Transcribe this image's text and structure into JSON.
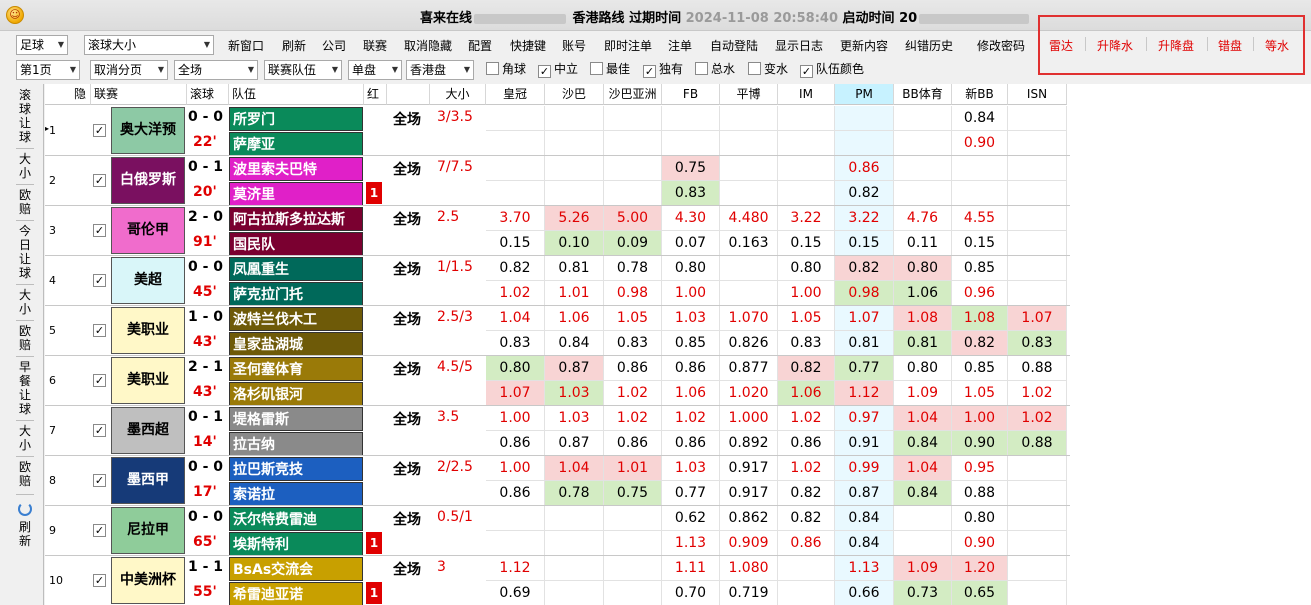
{
  "window": {
    "title_prefix": "喜来在线",
    "title_route": "香港路线",
    "title_expiry_label": "过期时间",
    "title_expiry": "2024-11-08 20:58:40",
    "title_start_label": "启动时间",
    "title_start": "20"
  },
  "toolbar1": {
    "sport_select": "足球",
    "market_select": "滚球大小",
    "buttons": [
      "新窗口",
      "刷新",
      "公司",
      "联赛",
      "取消隐藏",
      "配置",
      "快捷键",
      "账号",
      "即时注单",
      "注单",
      "自动登陆",
      "显示日志",
      "更新内容",
      "纠错历史",
      "修改密码"
    ],
    "red_buttons": [
      "雷达",
      "升降水",
      "升降盘",
      "错盘",
      "等水"
    ]
  },
  "toolbar2": {
    "page_select": "第1页",
    "paging_select": "取消分页",
    "period_select": "全场",
    "team_select": "联赛队伍",
    "line_select": "单盘",
    "odds_select": "香港盘",
    "checkboxes": [
      {
        "label": "角球",
        "checked": false
      },
      {
        "label": "中立",
        "checked": true
      },
      {
        "label": "最佳",
        "checked": false
      },
      {
        "label": "独有",
        "checked": true
      },
      {
        "label": "总水",
        "checked": false
      },
      {
        "label": "变水",
        "checked": false
      },
      {
        "label": "队伍颜色",
        "checked": true
      }
    ]
  },
  "side_tabs": [
    "滚球让球",
    "大小",
    "欧赔",
    "今日让球",
    "大小",
    "欧赔",
    "早餐让球",
    "大小",
    "欧赔",
    "刷新"
  ],
  "columns": {
    "hide": "隐",
    "league": "联赛",
    "live": "滚球",
    "team": "队伍",
    "red": "红",
    "total": "大小",
    "books": [
      "皇冠",
      "沙巴",
      "沙巴亚洲",
      "FB",
      "平博",
      "IM",
      "PM",
      "BB体育",
      "新BB",
      "ISN"
    ]
  },
  "colors": {
    "pink": "#f8d4d4",
    "green": "#d3ecc3",
    "red_text": "#e00000",
    "pm_header": "#c7f2ff"
  },
  "matches": [
    {
      "num": "1",
      "league": "奥大洋预",
      "league_bg": "#8dc9a5",
      "score": "0 - 0",
      "minute": "22'",
      "home": "所罗门",
      "away": "萨摩亚",
      "home_bg": "#0a8a5a",
      "away_bg": "#0a8a5a",
      "red": "",
      "period": "全场",
      "line": "3/3.5",
      "odds": [
        [
          [
            "",
            ""
          ],
          [
            "",
            ""
          ]
        ],
        [
          [
            "",
            ""
          ],
          [
            "",
            ""
          ]
        ],
        [
          [
            "",
            ""
          ],
          [
            "",
            ""
          ]
        ],
        [
          [
            "",
            ""
          ],
          [
            "",
            ""
          ]
        ],
        [
          [
            "",
            ""
          ],
          [
            "",
            ""
          ]
        ],
        [
          [
            "",
            ""
          ],
          [
            "",
            ""
          ]
        ],
        [
          [
            "",
            ""
          ],
          [
            "",
            ""
          ]
        ],
        [
          [
            "",
            ""
          ],
          [
            "",
            ""
          ]
        ],
        [
          [
            "0.84",
            ""
          ],
          [
            "0.90",
            "r"
          ]
        ],
        [
          [
            "",
            ""
          ],
          [
            "",
            ""
          ]
        ]
      ]
    },
    {
      "num": "2",
      "league": "白俄罗斯",
      "league_bg": "#7a1060",
      "score": "0 - 1",
      "minute": "20'",
      "home": "波里索夫巴特",
      "away": "莫济里",
      "home_bg": "#e020c8",
      "away_bg": "#e020c8",
      "red": "1",
      "period": "全场",
      "line": "7/7.5",
      "odds": [
        [
          [
            "",
            ""
          ],
          [
            "",
            ""
          ]
        ],
        [
          [
            "",
            ""
          ],
          [
            "",
            ""
          ]
        ],
        [
          [
            "",
            ""
          ],
          [
            "",
            ""
          ]
        ],
        [
          [
            "0.75",
            "p"
          ],
          [
            "0.83",
            "g"
          ]
        ],
        [
          [
            "",
            ""
          ],
          [
            "",
            ""
          ]
        ],
        [
          [
            "",
            ""
          ],
          [
            "",
            ""
          ]
        ],
        [
          [
            "0.86",
            "r"
          ],
          [
            "0.82",
            ""
          ]
        ],
        [
          [
            "",
            ""
          ],
          [
            "",
            ""
          ]
        ],
        [
          [
            "",
            ""
          ],
          [
            "",
            ""
          ]
        ],
        [
          [
            "",
            ""
          ],
          [
            "",
            ""
          ]
        ]
      ]
    },
    {
      "num": "3",
      "league": "哥伦甲",
      "league_bg": "#f06ccc",
      "score": "2 - 0",
      "minute": "91'",
      "home": "阿古拉斯多拉达斯",
      "away": "国民队",
      "home_bg": "#7a0030",
      "away_bg": "#7a0030",
      "red": "",
      "period": "全场",
      "line": "2.5",
      "odds": [
        [
          [
            "3.70",
            "r"
          ],
          [
            "0.15",
            ""
          ]
        ],
        [
          [
            "5.26",
            "pr"
          ],
          [
            "0.10",
            "g"
          ]
        ],
        [
          [
            "5.00",
            "pr"
          ],
          [
            "0.09",
            "g"
          ]
        ],
        [
          [
            "4.30",
            "r"
          ],
          [
            "0.07",
            ""
          ]
        ],
        [
          [
            "4.480",
            "r"
          ],
          [
            "0.163",
            ""
          ]
        ],
        [
          [
            "3.22",
            "r"
          ],
          [
            "0.15",
            ""
          ]
        ],
        [
          [
            "3.22",
            "r"
          ],
          [
            "0.15",
            ""
          ]
        ],
        [
          [
            "4.76",
            "r"
          ],
          [
            "0.11",
            ""
          ]
        ],
        [
          [
            "4.55",
            "r"
          ],
          [
            "0.15",
            ""
          ]
        ],
        [
          [
            "",
            ""
          ],
          [
            "",
            ""
          ]
        ]
      ]
    },
    {
      "num": "4",
      "league": "美超",
      "league_bg": "#d9f6f9",
      "score": "0 - 0",
      "minute": "45'",
      "home": "凤凰重生",
      "away": "萨克拉门托",
      "home_bg": "#00695a",
      "away_bg": "#00695a",
      "red": "",
      "period": "全场",
      "line": "1/1.5",
      "odds": [
        [
          [
            "0.82",
            ""
          ],
          [
            "1.02",
            "r"
          ]
        ],
        [
          [
            "0.81",
            ""
          ],
          [
            "1.01",
            "r"
          ]
        ],
        [
          [
            "0.78",
            ""
          ],
          [
            "0.98",
            "r"
          ]
        ],
        [
          [
            "0.80",
            ""
          ],
          [
            "1.00",
            "r"
          ]
        ],
        [
          [
            "",
            ""
          ],
          [
            "",
            ""
          ]
        ],
        [
          [
            "0.80",
            ""
          ],
          [
            "1.00",
            "r"
          ]
        ],
        [
          [
            "0.82",
            "p"
          ],
          [
            "0.98",
            "gr"
          ]
        ],
        [
          [
            "0.80",
            "p"
          ],
          [
            "1.06",
            "g"
          ]
        ],
        [
          [
            "0.85",
            ""
          ],
          [
            "0.96",
            "r"
          ]
        ],
        [
          [
            "",
            ""
          ],
          [
            "",
            ""
          ]
        ]
      ]
    },
    {
      "num": "5",
      "league": "美职业",
      "league_bg": "#fff8c8",
      "score": "1 - 0",
      "minute": "43'",
      "home": "波特兰伐木工",
      "away": "皇家盐湖城",
      "home_bg": "#6e5a08",
      "away_bg": "#6e5a08",
      "red": "",
      "period": "全场",
      "line": "2.5/3",
      "odds": [
        [
          [
            "1.04",
            "r"
          ],
          [
            "0.83",
            ""
          ]
        ],
        [
          [
            "1.06",
            "r"
          ],
          [
            "0.84",
            ""
          ]
        ],
        [
          [
            "1.05",
            "r"
          ],
          [
            "0.83",
            ""
          ]
        ],
        [
          [
            "1.03",
            "r"
          ],
          [
            "0.85",
            ""
          ]
        ],
        [
          [
            "1.070",
            "r"
          ],
          [
            "0.826",
            ""
          ]
        ],
        [
          [
            "1.05",
            "r"
          ],
          [
            "0.83",
            ""
          ]
        ],
        [
          [
            "1.07",
            "r"
          ],
          [
            "0.81",
            ""
          ]
        ],
        [
          [
            "1.08",
            "pr"
          ],
          [
            "0.81",
            "g"
          ]
        ],
        [
          [
            "1.08",
            "gr"
          ],
          [
            "0.82",
            "p"
          ]
        ],
        [
          [
            "1.07",
            "pr"
          ],
          [
            "0.83",
            "g"
          ]
        ]
      ]
    },
    {
      "num": "6",
      "league": "美职业",
      "league_bg": "#fff8c8",
      "score": "2 - 1",
      "minute": "43'",
      "home": "圣何塞体育",
      "away": "洛杉矶银河",
      "home_bg": "#9a7a08",
      "away_bg": "#9a7a08",
      "red": "",
      "period": "全场",
      "line": "4.5/5",
      "odds": [
        [
          [
            "0.80",
            "g"
          ],
          [
            "1.07",
            "pr"
          ]
        ],
        [
          [
            "0.87",
            "p"
          ],
          [
            "1.03",
            "gr"
          ]
        ],
        [
          [
            "0.86",
            ""
          ],
          [
            "1.02",
            "r"
          ]
        ],
        [
          [
            "0.86",
            ""
          ],
          [
            "1.06",
            "r"
          ]
        ],
        [
          [
            "0.877",
            ""
          ],
          [
            "1.020",
            "r"
          ]
        ],
        [
          [
            "0.82",
            "p"
          ],
          [
            "1.06",
            "gr"
          ]
        ],
        [
          [
            "0.77",
            "g"
          ],
          [
            "1.12",
            "pr"
          ]
        ],
        [
          [
            "0.80",
            ""
          ],
          [
            "1.09",
            "r"
          ]
        ],
        [
          [
            "0.85",
            ""
          ],
          [
            "1.05",
            "r"
          ]
        ],
        [
          [
            "0.88",
            ""
          ],
          [
            "1.02",
            "r"
          ]
        ]
      ]
    },
    {
      "num": "7",
      "league": "墨西超",
      "league_bg": "#bfbfbf",
      "score": "0 - 1",
      "minute": "14'",
      "home": "堤格雷斯",
      "away": "拉古纳",
      "home_bg": "#8a8a8a",
      "away_bg": "#8a8a8a",
      "red": "",
      "period": "全场",
      "line": "3.5",
      "odds": [
        [
          [
            "1.00",
            "r"
          ],
          [
            "0.86",
            ""
          ]
        ],
        [
          [
            "1.03",
            "r"
          ],
          [
            "0.87",
            ""
          ]
        ],
        [
          [
            "1.02",
            "r"
          ],
          [
            "0.86",
            ""
          ]
        ],
        [
          [
            "1.02",
            "r"
          ],
          [
            "0.86",
            ""
          ]
        ],
        [
          [
            "1.000",
            "r"
          ],
          [
            "0.892",
            ""
          ]
        ],
        [
          [
            "1.02",
            "r"
          ],
          [
            "0.86",
            ""
          ]
        ],
        [
          [
            "0.97",
            "r"
          ],
          [
            "0.91",
            ""
          ]
        ],
        [
          [
            "1.04",
            "pr"
          ],
          [
            "0.84",
            "g"
          ]
        ],
        [
          [
            "1.00",
            "pr"
          ],
          [
            "0.90",
            "g"
          ]
        ],
        [
          [
            "1.02",
            "pr"
          ],
          [
            "0.88",
            "g"
          ]
        ]
      ]
    },
    {
      "num": "8",
      "league": "墨西甲",
      "league_bg": "#163a78",
      "score": "0 - 0",
      "minute": "17'",
      "home": "拉巴斯竞技",
      "away": "索诺拉",
      "home_bg": "#1c5fc0",
      "away_bg": "#1c5fc0",
      "red": "",
      "period": "全场",
      "line": "2/2.5",
      "odds": [
        [
          [
            "1.00",
            "r"
          ],
          [
            "0.86",
            ""
          ]
        ],
        [
          [
            "1.04",
            "pr"
          ],
          [
            "0.78",
            "g"
          ]
        ],
        [
          [
            "1.01",
            "pr"
          ],
          [
            "0.75",
            "g"
          ]
        ],
        [
          [
            "1.03",
            "r"
          ],
          [
            "0.77",
            ""
          ]
        ],
        [
          [
            "0.917",
            ""
          ],
          [
            "0.917",
            ""
          ]
        ],
        [
          [
            "1.02",
            "r"
          ],
          [
            "0.82",
            ""
          ]
        ],
        [
          [
            "0.99",
            "r"
          ],
          [
            "0.87",
            ""
          ]
        ],
        [
          [
            "1.04",
            "pr"
          ],
          [
            "0.84",
            "g"
          ]
        ],
        [
          [
            "0.95",
            "r"
          ],
          [
            "0.88",
            ""
          ]
        ],
        [
          [
            "",
            ""
          ],
          [
            "",
            ""
          ]
        ]
      ]
    },
    {
      "num": "9",
      "league": "尼拉甲",
      "league_bg": "#8fcc9a",
      "score": "0 - 0",
      "minute": "65'",
      "home": "沃尔特费雷迪",
      "away": "埃斯特利",
      "home_bg": "#0a8a5a",
      "away_bg": "#0a8a5a",
      "red": "1",
      "period": "全场",
      "line": "0.5/1",
      "odds": [
        [
          [
            "",
            ""
          ],
          [
            "",
            ""
          ]
        ],
        [
          [
            "",
            ""
          ],
          [
            "",
            ""
          ]
        ],
        [
          [
            "",
            ""
          ],
          [
            "",
            ""
          ]
        ],
        [
          [
            "0.62",
            ""
          ],
          [
            "1.13",
            "r"
          ]
        ],
        [
          [
            "0.862",
            ""
          ],
          [
            "0.909",
            "r"
          ]
        ],
        [
          [
            "0.82",
            ""
          ],
          [
            "0.86",
            "r"
          ]
        ],
        [
          [
            "0.84",
            ""
          ],
          [
            "0.84",
            ""
          ]
        ],
        [
          [
            "",
            ""
          ],
          [
            "",
            ""
          ]
        ],
        [
          [
            "0.80",
            ""
          ],
          [
            "0.90",
            "r"
          ]
        ],
        [
          [
            "",
            ""
          ],
          [
            "",
            ""
          ]
        ]
      ]
    },
    {
      "num": "10",
      "league": "中美洲杯",
      "league_bg": "#fff8c8",
      "score": "1 - 1",
      "minute": "55'",
      "home": "BsAs交流会",
      "away": "希雷迪亚诺",
      "home_bg": "#c8a000",
      "away_bg": "#c8a000",
      "red": "1",
      "period": "全场",
      "line": "3",
      "odds": [
        [
          [
            "1.12",
            "r"
          ],
          [
            "0.69",
            ""
          ]
        ],
        [
          [
            "",
            ""
          ],
          [
            "",
            ""
          ]
        ],
        [
          [
            "",
            ""
          ],
          [
            "",
            ""
          ]
        ],
        [
          [
            "1.11",
            "r"
          ],
          [
            "0.70",
            ""
          ]
        ],
        [
          [
            "1.080",
            "r"
          ],
          [
            "0.719",
            ""
          ]
        ],
        [
          [
            "",
            ""
          ],
          [
            "",
            ""
          ]
        ],
        [
          [
            "1.13",
            "r"
          ],
          [
            "0.66",
            ""
          ]
        ],
        [
          [
            "1.09",
            "pr"
          ],
          [
            "0.73",
            "g"
          ]
        ],
        [
          [
            "1.20",
            "pr"
          ],
          [
            "0.65",
            "g"
          ]
        ],
        [
          [
            "",
            ""
          ],
          [
            "",
            ""
          ]
        ]
      ]
    }
  ]
}
